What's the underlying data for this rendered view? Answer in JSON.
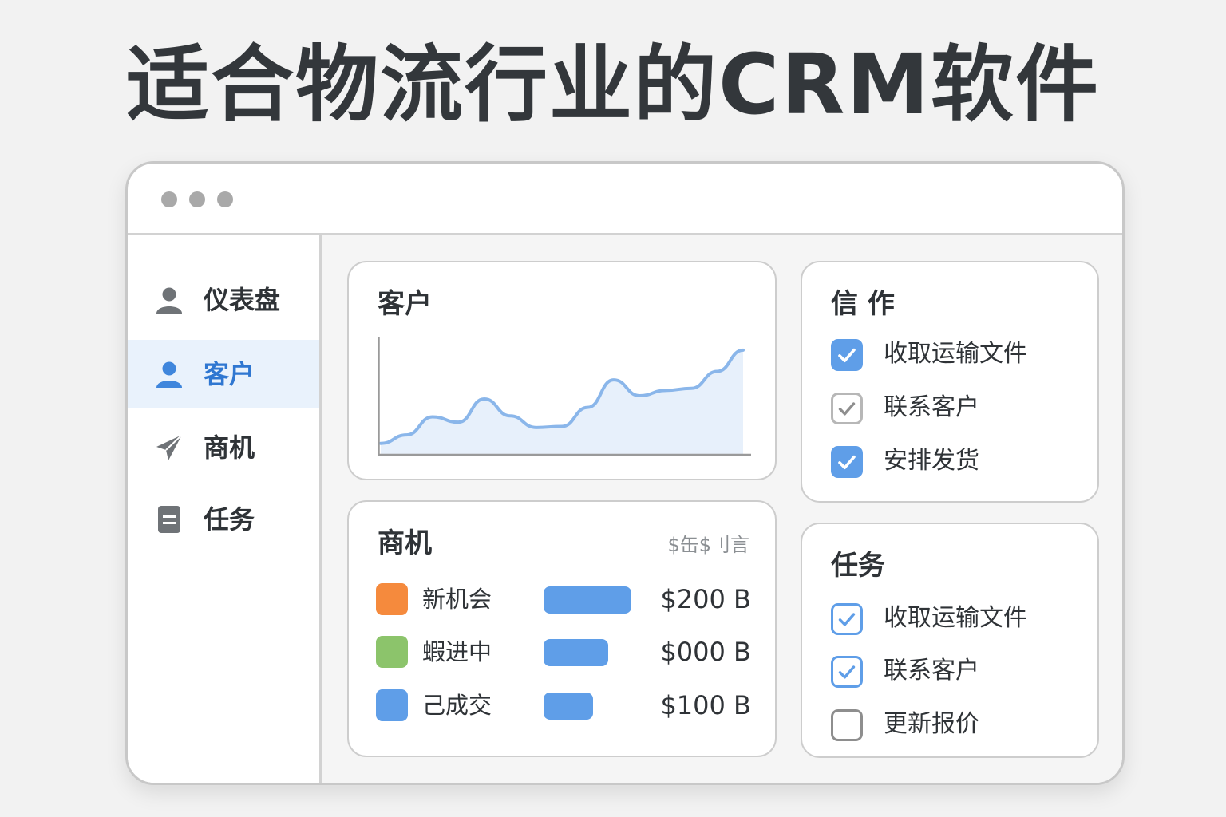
{
  "headline": "适合物流行业的CRM软件",
  "sidebar": {
    "items": [
      {
        "label": "仪表盘",
        "icon": "user-icon",
        "active": false
      },
      {
        "label": "客户",
        "icon": "user-icon",
        "active": true
      },
      {
        "label": "商机",
        "icon": "paper-plane-icon",
        "active": false
      },
      {
        "label": "任务",
        "icon": "document-icon",
        "active": false
      }
    ]
  },
  "customers_card": {
    "title": "客户",
    "chart_data": {
      "type": "area",
      "title": "",
      "xlabel": "",
      "ylabel": "",
      "x": [
        0,
        1,
        2,
        3,
        4,
        5,
        6,
        7,
        8,
        9,
        10,
        11,
        12,
        13,
        14,
        15,
        16,
        17,
        18,
        19,
        20
      ],
      "y": [
        10,
        18,
        35,
        30,
        52,
        36,
        25,
        26,
        44,
        70,
        55,
        60,
        62,
        78,
        98
      ],
      "ylim": [
        0,
        110
      ],
      "grid": false,
      "color": "#8ab6ea",
      "fill": "#e7f0fb"
    }
  },
  "opportunities_card": {
    "title": "商机",
    "header_note": "$缶$刂言",
    "rows": [
      {
        "label": "新机会",
        "swatch": "#f58a3d",
        "bar_fraction": 1.0,
        "value": "$200 B"
      },
      {
        "label": "蝦进中",
        "swatch": "#8cc46b",
        "bar_fraction": 0.74,
        "value": "$000 B"
      },
      {
        "label": "己成交",
        "swatch": "#5f9ee8",
        "bar_fraction": 0.56,
        "value": "$100 B"
      }
    ]
  },
  "cooperation_card": {
    "title": "信 作",
    "items": [
      {
        "label": "收取运输文件",
        "checked": true,
        "style": "filled"
      },
      {
        "label": "联系客户",
        "checked": true,
        "style": "gray"
      },
      {
        "label": "安排发货",
        "checked": true,
        "style": "filled"
      }
    ]
  },
  "tasks_card": {
    "title": "任务",
    "items": [
      {
        "label": "收取运输文件",
        "checked": true,
        "style": "outline"
      },
      {
        "label": "联系客户",
        "checked": true,
        "style": "outline"
      },
      {
        "label": "更新报价",
        "checked": false,
        "style": "empty"
      }
    ]
  },
  "colors": {
    "accent": "#2f77d1",
    "checkbox_fill": "#5f9ee8",
    "checkbox_outline": "#5f9ee8",
    "checkbox_gray": "#b7b7b7"
  }
}
